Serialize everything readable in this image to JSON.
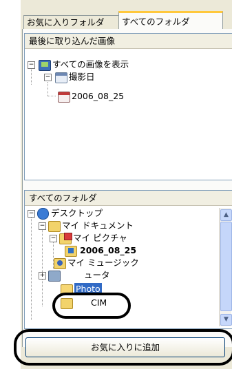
{
  "tabs": {
    "favorites": "お気に入りフォルダ",
    "all_folders": "すべてのフォルダ"
  },
  "recent_import": {
    "header": "最後に取り込んだ画像",
    "items": [
      {
        "label": "すべての画像を表示",
        "icon": "monitor-icon"
      },
      {
        "label": "撮影日",
        "icon": "calendar-icon"
      },
      {
        "label": "2006_08_25",
        "icon": "dated-calendar-icon"
      }
    ]
  },
  "all_folders_panel": {
    "header": "すべてのフォルダ",
    "items": [
      {
        "label": "デスクトップ",
        "icon": "desktop-icon"
      },
      {
        "label": "マイ ドキュメント",
        "icon": "my-documents-icon"
      },
      {
        "label": "マイ ピクチャ",
        "icon": "my-pictures-icon"
      },
      {
        "label": "2006_08_25",
        "icon": "import-folder-icon"
      },
      {
        "label": "マイ ミュージック",
        "icon": "my-music-icon"
      },
      {
        "label": "ュータ",
        "icon": "computer-icon"
      },
      {
        "label": "Photo",
        "icon": "folder-open-icon"
      },
      {
        "label": "CIM",
        "icon": "folder-icon"
      }
    ]
  },
  "add_button": "お気に入りに追加",
  "colors": {
    "selection": "#316ac5",
    "active_tab_accent": "#ffc83c",
    "frame": "#ece9d8",
    "border": "#7f9db9",
    "annotation": "#000000"
  }
}
